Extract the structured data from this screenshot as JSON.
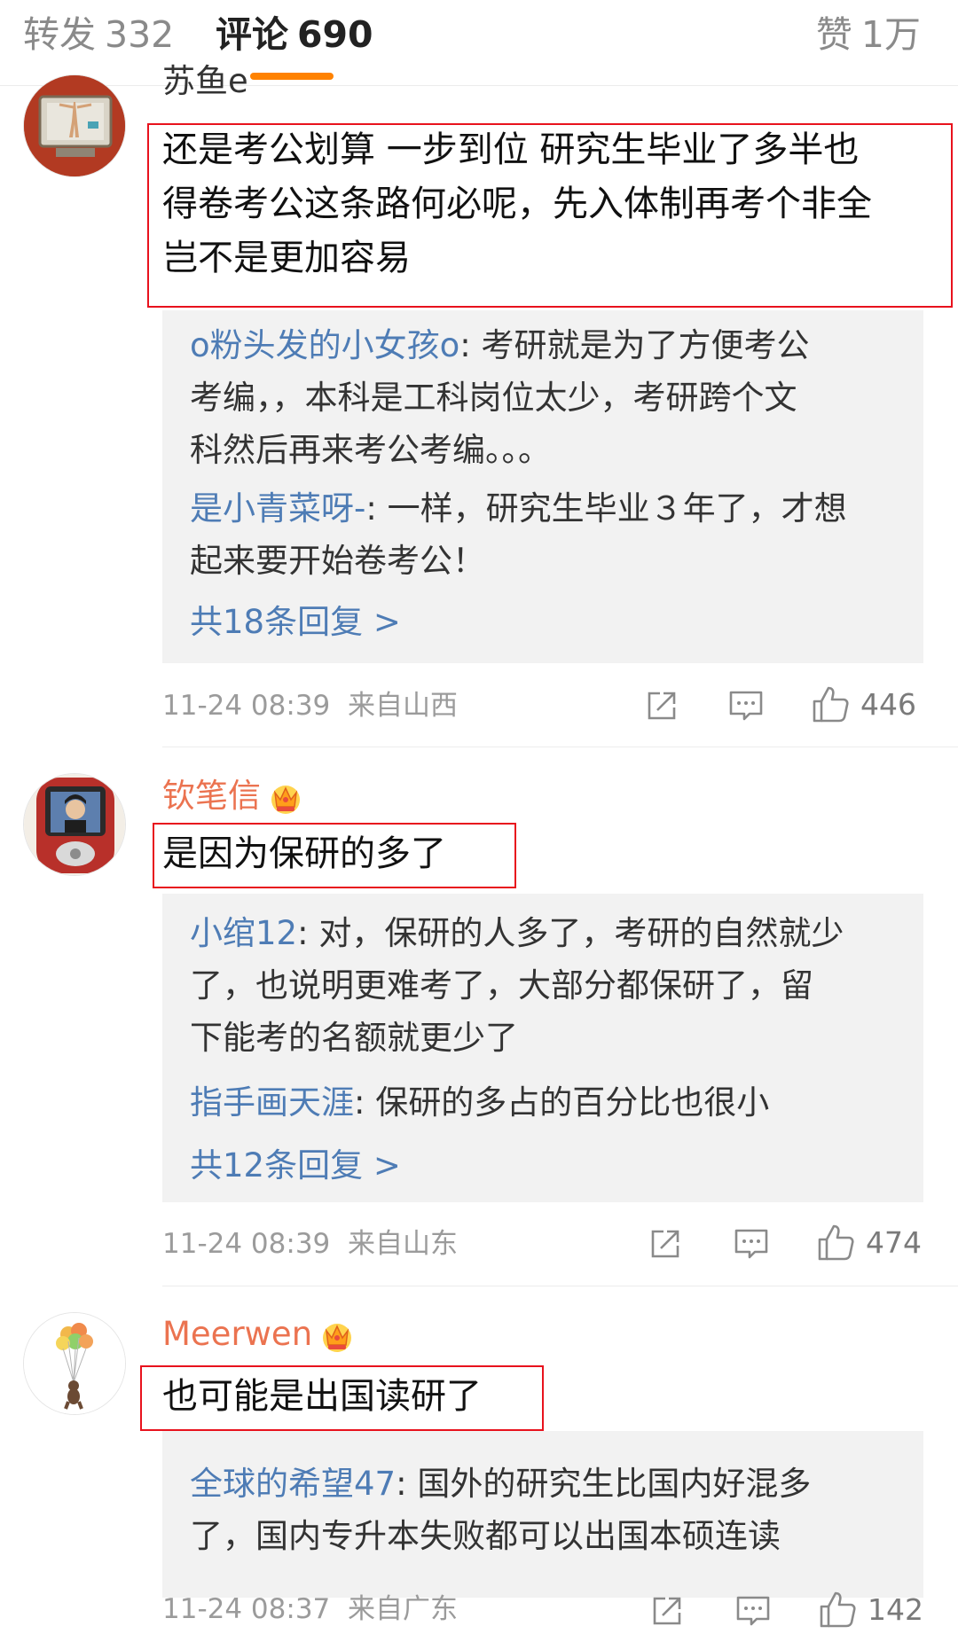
{
  "tabs": {
    "repost": {
      "label": "转发",
      "count": "332"
    },
    "comments": {
      "label": "评论",
      "count": "690"
    },
    "likes": {
      "label": "赞",
      "count": "1万"
    }
  },
  "accent_color": "#ff8200",
  "highlight_color": "#e8121d",
  "comments": [
    {
      "username": "苏鱼e",
      "lines": [
        "还是考公划算 一步到位 研究生毕业了多半也",
        "得卷考公这条路何必呢，先入体制再考个非全",
        "岂不是更加容易"
      ],
      "replies": [
        {
          "author": "o粉头发的小女孩o",
          "lines": [
            "考研就是为了方便考公",
            "考编，，本科是工科岗位太少，考研跨个文",
            "科然后再来考公考编。。。"
          ]
        },
        {
          "author": "是小青菜呀-",
          "lines": [
            "一样，研究生毕业３年了，才想",
            "起来要开始卷考公！"
          ]
        }
      ],
      "more_replies": "共18条回复 >",
      "timestamp": "11-24 08:39",
      "location": "来自山西",
      "likes": "446"
    },
    {
      "username": "钦笔信",
      "lines": [
        "是因为保研的多了"
      ],
      "replies": [
        {
          "author": "小绾12",
          "lines": [
            "对，保研的人多了，考研的自然就少",
            "了，也说明更难考了，大部分都保研了，留",
            "下能考的名额就更少了"
          ]
        },
        {
          "author": "指手画天涯",
          "lines": [
            "保研的多占的百分比也很小"
          ]
        }
      ],
      "more_replies": "共12条回复 >",
      "timestamp": "11-24 08:39",
      "location": "来自山东",
      "likes": "474"
    },
    {
      "username": "Meerwen",
      "lines": [
        "也可能是出国读研了"
      ],
      "replies": [
        {
          "author": "全球的希望47",
          "lines": [
            "国外的研究生比国内好混多",
            "了，国内专升本失败都可以出国本硕连读"
          ]
        }
      ],
      "timestamp": "11-24 08:37",
      "location": "来自广东",
      "likes": "142"
    }
  ],
  "icons": [
    "share-icon",
    "comment-icon",
    "like-icon",
    "vip-crown-icon"
  ]
}
